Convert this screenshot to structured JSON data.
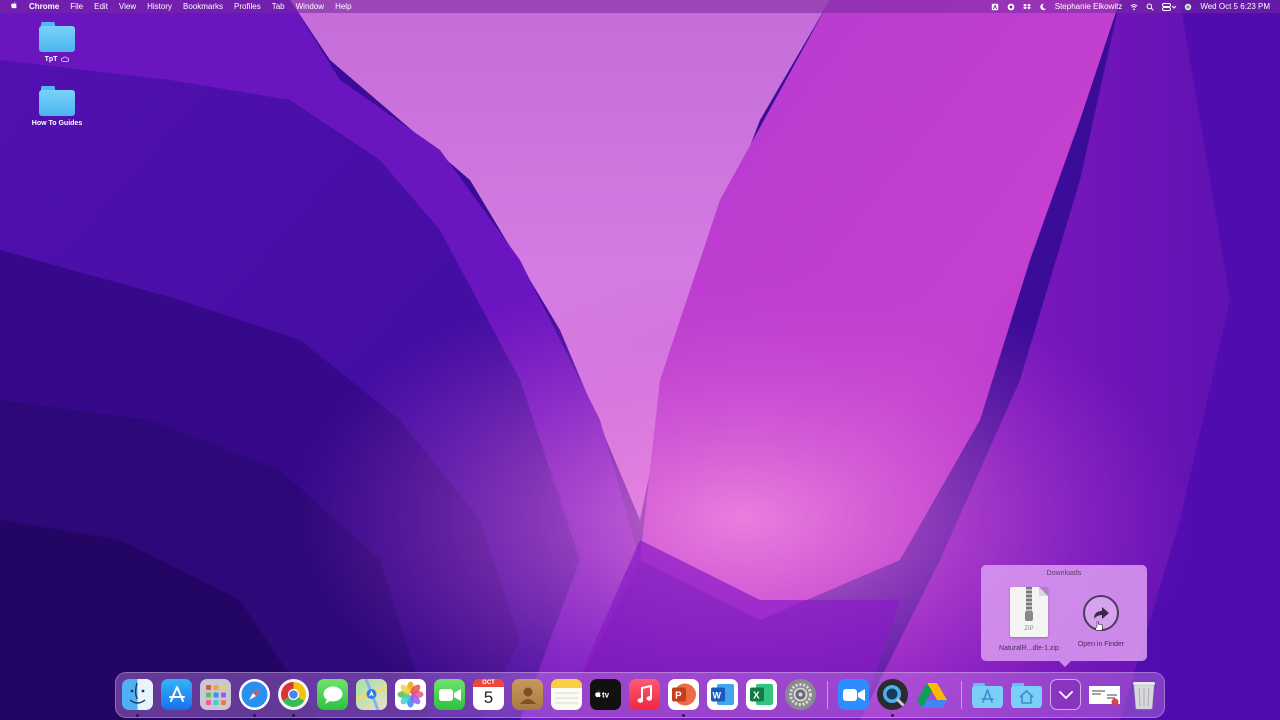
{
  "menubar": {
    "apple": "",
    "app_name": "Chrome",
    "menus": [
      "File",
      "Edit",
      "View",
      "History",
      "Bookmarks",
      "Profiles",
      "Tab",
      "Window",
      "Help"
    ],
    "user_name": "Stephanie Elkowitz",
    "datetime": "Wed Oct 5  6:23 PM",
    "status_icons": [
      "accessibility-icon",
      "record-icon",
      "dropbox-icon",
      "moon-icon",
      "wifi-icon",
      "search-icon",
      "control-center-icon",
      "siri-icon"
    ]
  },
  "desktop": {
    "items": [
      {
        "label": "TpT",
        "icon": "folder-icon",
        "badge": "icloud-icon"
      },
      {
        "label": "How To Guides",
        "icon": "folder-icon"
      }
    ]
  },
  "downloads_popover": {
    "title": "Downloads",
    "file_name": "NaturalR...dle-1.zip",
    "file_type_label": "ZIP",
    "open_label": "Open in Finder"
  },
  "calendar": {
    "month": "OCT",
    "day": "5"
  },
  "dock": {
    "apps": [
      "finder",
      "app-store",
      "launchpad",
      "safari",
      "chrome",
      "messages",
      "maps",
      "photos",
      "facetime",
      "calendar",
      "contacts",
      "notes",
      "apple-tv",
      "music",
      "powerpoint",
      "word",
      "excel",
      "system-preferences",
      "zoom",
      "quicktime",
      "google-drive"
    ],
    "stacks": [
      "applications-folder",
      "home-folder",
      "downloads-stack",
      "document",
      "trash"
    ]
  },
  "colors": {
    "wallpaper_dark": "#2a0a78",
    "wallpaper_purple": "#5a14b4",
    "wallpaper_pink": "#c43fd4",
    "wallpaper_light": "#d77be0",
    "folder_blue": "#5ec4f6",
    "popover_bg": "#d696ee"
  }
}
